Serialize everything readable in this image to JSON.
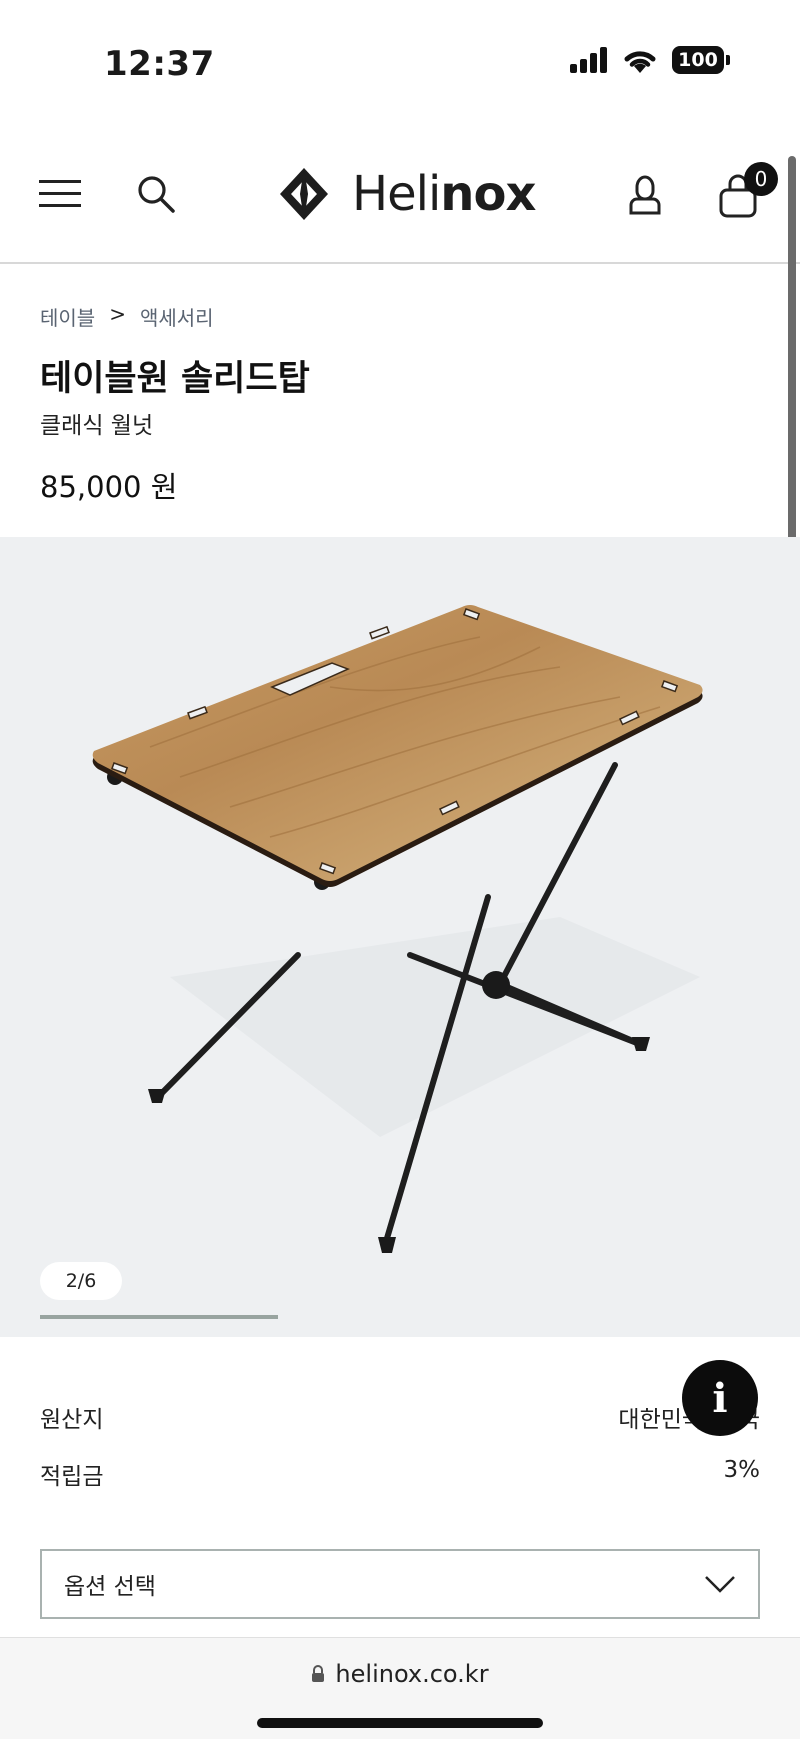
{
  "status": {
    "time": "12:37",
    "battery": "100"
  },
  "header": {
    "brand": "Helinox",
    "brand_light": "Heli",
    "brand_bold": "nox",
    "cart_count": "0"
  },
  "breadcrumb": {
    "items": [
      "테이블",
      "액세서리"
    ],
    "separator": ">"
  },
  "product": {
    "title": "테이블원 솔리드탑",
    "color": "클래식 월넛",
    "price": "85,000 원"
  },
  "gallery": {
    "counter": "2/6",
    "progress": 0.33
  },
  "info": [
    {
      "label": "원산지",
      "value": "대한민국, 중국"
    },
    {
      "label": "적립금",
      "value": "3%"
    }
  ],
  "option_select": {
    "placeholder": "옵션 선택"
  },
  "browser": {
    "url": "helinox.co.kr"
  },
  "colors": {
    "accent": "#111111",
    "gallery_bg": "#eef0f2",
    "progress": "#98a4a0"
  }
}
